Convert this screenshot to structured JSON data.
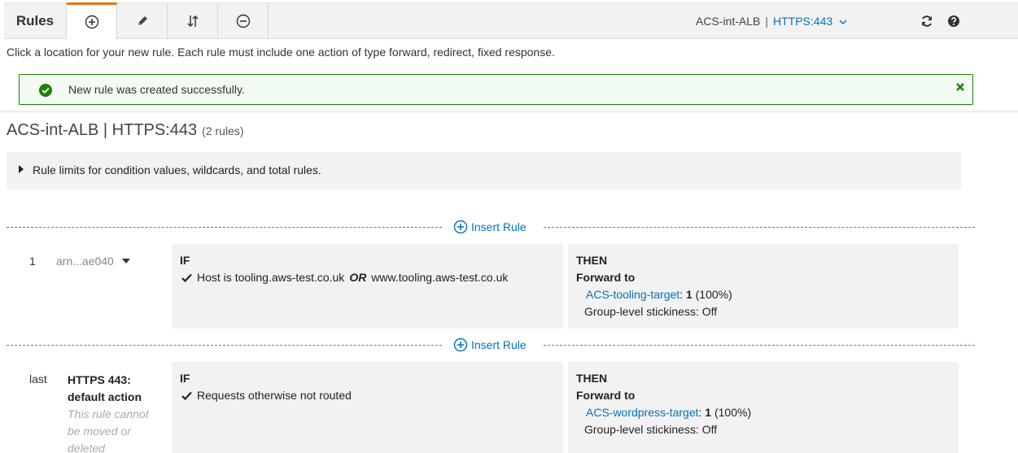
{
  "toolbar": {
    "title": "Rules",
    "tabs": [
      {
        "name": "add-icon"
      },
      {
        "name": "edit-icon"
      },
      {
        "name": "reorder-icon"
      },
      {
        "name": "delete-icon"
      }
    ],
    "listener_name": "ACS-int-ALB",
    "listener_separator": "|",
    "listener_port": "HTTPS:443",
    "accent_color": "#ec7211"
  },
  "instructions": "Click a location for your new rule. Each rule must include one action of type forward, redirect, fixed response.",
  "flash": {
    "message": "New rule was created successfully.",
    "status_color": "#1d8102"
  },
  "page": {
    "title": "ACS-int-ALB | HTTPS:443",
    "rule_count": "(2 rules)"
  },
  "limits_text": "Rule limits for condition values, wildcards, and total rules.",
  "insert_label": "Insert Rule",
  "rules": [
    {
      "number": "1",
      "arn": "arn...ae040",
      "if_header": "IF",
      "condition_prefix": "Host is",
      "condition_host_1": "tooling.aws-test.co.uk",
      "condition_or": "OR",
      "condition_host_2": "www.tooling.aws-test.co.uk",
      "then_header": "THEN",
      "action": "Forward to",
      "target": "ACS-tooling-target",
      "target_sep": ":",
      "weight": "1",
      "percent": "(100%)",
      "stickiness": "Group-level stickiness: Off"
    },
    {
      "number": "last",
      "label_line1": "HTTPS 443:",
      "label_line2": "default action",
      "note": "This rule cannot be moved or deleted",
      "if_header": "IF",
      "condition": "Requests otherwise not routed",
      "then_header": "THEN",
      "action": "Forward to",
      "target": "ACS-wordpress-target",
      "target_sep": ":",
      "weight": "1",
      "percent": "(100%)",
      "stickiness": "Group-level stickiness: Off"
    }
  ]
}
